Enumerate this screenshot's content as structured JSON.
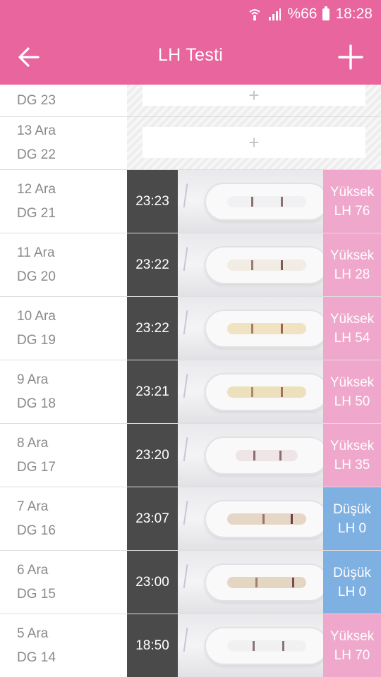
{
  "status_bar": {
    "battery_text": "%66",
    "time": "18:28",
    "icons": [
      "wifi-calling-icon",
      "signal-icon",
      "battery-icon"
    ]
  },
  "app_bar": {
    "title": "LH Testi",
    "back_icon": "arrow-left-icon",
    "add_icon": "plus-icon"
  },
  "colors": {
    "primary": "#e8659e",
    "high": "#f0a7cc",
    "low": "#7fb0e2",
    "time_bg": "#4a4a4a",
    "date_text": "#8a8a8a"
  },
  "rows": [
    {
      "date": "",
      "cycle_day": "DG 23",
      "empty": true,
      "add_label": "+"
    },
    {
      "date": "13 Ara",
      "cycle_day": "DG 22",
      "empty": true,
      "add_label": "+"
    },
    {
      "date": "12 Ara",
      "cycle_day": "DG 21",
      "time": "23:23",
      "result_label": "Yüksek",
      "lh_text": "LH 76",
      "level": "high",
      "lh_value": 76
    },
    {
      "date": "11 Ara",
      "cycle_day": "DG 20",
      "time": "23:22",
      "result_label": "Yüksek",
      "lh_text": "LH 28",
      "level": "high",
      "lh_value": 28
    },
    {
      "date": "10 Ara",
      "cycle_day": "DG 19",
      "time": "23:22",
      "result_label": "Yüksek",
      "lh_text": "LH 54",
      "level": "high",
      "lh_value": 54
    },
    {
      "date": "9 Ara",
      "cycle_day": "DG 18",
      "time": "23:21",
      "result_label": "Yüksek",
      "lh_text": "LH 50",
      "level": "high",
      "lh_value": 50
    },
    {
      "date": "8 Ara",
      "cycle_day": "DG 17",
      "time": "23:20",
      "result_label": "Yüksek",
      "lh_text": "LH 35",
      "level": "high",
      "lh_value": 35
    },
    {
      "date": "7 Ara",
      "cycle_day": "DG 16",
      "time": "23:07",
      "result_label": "Düşük",
      "lh_text": "LH 0",
      "level": "low",
      "lh_value": 0
    },
    {
      "date": "6 Ara",
      "cycle_day": "DG 15",
      "time": "23:00",
      "result_label": "Düşük",
      "lh_text": "LH 0",
      "level": "low",
      "lh_value": 0
    },
    {
      "date": "5 Ara",
      "cycle_day": "DG 14",
      "time": "18:50",
      "result_label": "Yüksek",
      "lh_text": "LH 70",
      "level": "high",
      "lh_value": 70
    }
  ]
}
